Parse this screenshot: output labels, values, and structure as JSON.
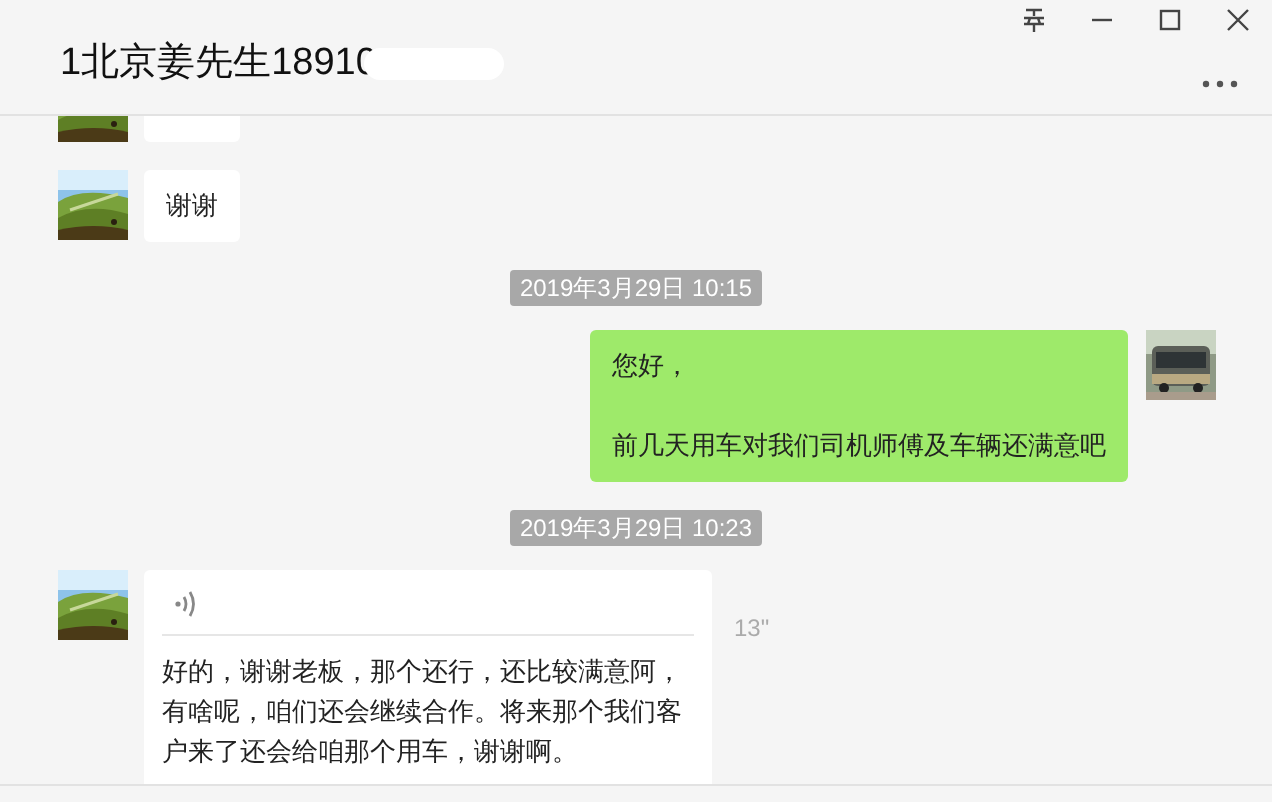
{
  "window": {
    "title": "1北京姜先生18910"
  },
  "messages": [
    {
      "kind": "cut_off",
      "outgoing": false
    },
    {
      "kind": "text",
      "outgoing": false,
      "lines": [
        "谢谢"
      ]
    },
    {
      "kind": "timestamp",
      "text": "2019年3月29日 10:15"
    },
    {
      "kind": "text",
      "outgoing": true,
      "lines": [
        "您好，",
        "前几天用车对我们司机师傅及车辆还满意吧"
      ]
    },
    {
      "kind": "timestamp",
      "text": "2019年3月29日 10:23"
    },
    {
      "kind": "voice",
      "outgoing": false,
      "duration": "13\"",
      "transcript": "好的，谢谢老板，那个还行，还比较满意阿，有啥呢，咱们还会继续合作。将来那个我们客户来了还会给咱那个用车，谢谢啊。"
    }
  ]
}
